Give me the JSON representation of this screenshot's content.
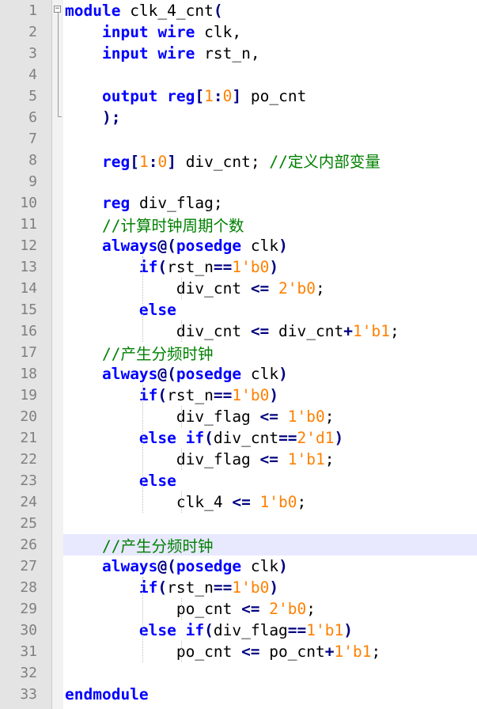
{
  "editor": {
    "current_line": 26,
    "colors": {
      "keyword": "#0000ff",
      "number": "#ff8000",
      "operator": "#000080",
      "comment": "#008000",
      "identifier": "#000000",
      "line_number": "#808080",
      "current_line_bg": "#e8e8ff",
      "gutter_bg": "#e4e4e4"
    },
    "lines": [
      {
        "n": "1",
        "tokens": [
          [
            "kw",
            "module"
          ],
          [
            "id",
            " clk_4_cnt"
          ],
          [
            "op",
            "("
          ]
        ]
      },
      {
        "n": "2",
        "tokens": [
          [
            "id",
            "    "
          ],
          [
            "kw",
            "input"
          ],
          [
            "id",
            " "
          ],
          [
            "kw",
            "wire"
          ],
          [
            "id",
            " clk,"
          ]
        ]
      },
      {
        "n": "3",
        "tokens": [
          [
            "id",
            "    "
          ],
          [
            "kw",
            "input"
          ],
          [
            "id",
            " "
          ],
          [
            "kw",
            "wire"
          ],
          [
            "id",
            " rst_n,"
          ]
        ]
      },
      {
        "n": "4",
        "tokens": []
      },
      {
        "n": "5",
        "tokens": [
          [
            "id",
            "    "
          ],
          [
            "kw",
            "output"
          ],
          [
            "id",
            " "
          ],
          [
            "kw",
            "reg"
          ],
          [
            "op",
            "["
          ],
          [
            "num",
            "1"
          ],
          [
            "op",
            ":"
          ],
          [
            "num",
            "0"
          ],
          [
            "op",
            "]"
          ],
          [
            "id",
            " po_cnt"
          ]
        ]
      },
      {
        "n": "6",
        "tokens": [
          [
            "id",
            "    "
          ],
          [
            "op",
            ");"
          ]
        ]
      },
      {
        "n": "7",
        "tokens": []
      },
      {
        "n": "8",
        "tokens": [
          [
            "id",
            "    "
          ],
          [
            "kw",
            "reg"
          ],
          [
            "op",
            "["
          ],
          [
            "num",
            "1"
          ],
          [
            "op",
            ":"
          ],
          [
            "num",
            "0"
          ],
          [
            "op",
            "]"
          ],
          [
            "id",
            " div_cnt; "
          ],
          [
            "cm",
            "//定义内部变量"
          ]
        ]
      },
      {
        "n": "9",
        "tokens": []
      },
      {
        "n": "10",
        "tokens": [
          [
            "id",
            "    "
          ],
          [
            "kw",
            "reg"
          ],
          [
            "id",
            " div_flag;"
          ]
        ]
      },
      {
        "n": "11",
        "tokens": [
          [
            "id",
            "    "
          ],
          [
            "cm",
            "//计算时钟周期个数"
          ]
        ]
      },
      {
        "n": "12",
        "tokens": [
          [
            "id",
            "    "
          ],
          [
            "kw",
            "always"
          ],
          [
            "op",
            "@("
          ],
          [
            "kw",
            "posedge"
          ],
          [
            "id",
            " clk"
          ],
          [
            "op",
            ")"
          ]
        ]
      },
      {
        "n": "13",
        "tokens": [
          [
            "id",
            "        "
          ],
          [
            "kw",
            "if"
          ],
          [
            "op",
            "("
          ],
          [
            "id",
            "rst_n"
          ],
          [
            "op",
            "=="
          ],
          [
            "num",
            "1'b0"
          ],
          [
            "op",
            ")"
          ]
        ]
      },
      {
        "n": "14",
        "tokens": [
          [
            "id",
            "            div_cnt "
          ],
          [
            "op",
            "<="
          ],
          [
            "id",
            " "
          ],
          [
            "num",
            "2'b0"
          ],
          [
            "id",
            ";"
          ]
        ]
      },
      {
        "n": "15",
        "tokens": [
          [
            "id",
            "        "
          ],
          [
            "kw",
            "else"
          ]
        ]
      },
      {
        "n": "16",
        "tokens": [
          [
            "id",
            "            div_cnt "
          ],
          [
            "op",
            "<="
          ],
          [
            "id",
            " div_cnt"
          ],
          [
            "op",
            "+"
          ],
          [
            "num",
            "1'b1"
          ],
          [
            "id",
            ";"
          ]
        ]
      },
      {
        "n": "17",
        "tokens": [
          [
            "id",
            "    "
          ],
          [
            "cm",
            "//产生分频时钟"
          ]
        ]
      },
      {
        "n": "18",
        "tokens": [
          [
            "id",
            "    "
          ],
          [
            "kw",
            "always"
          ],
          [
            "op",
            "@("
          ],
          [
            "kw",
            "posedge"
          ],
          [
            "id",
            " clk"
          ],
          [
            "op",
            ")"
          ]
        ]
      },
      {
        "n": "19",
        "tokens": [
          [
            "id",
            "        "
          ],
          [
            "kw",
            "if"
          ],
          [
            "op",
            "("
          ],
          [
            "id",
            "rst_n"
          ],
          [
            "op",
            "=="
          ],
          [
            "num",
            "1'b0"
          ],
          [
            "op",
            ")"
          ]
        ]
      },
      {
        "n": "20",
        "tokens": [
          [
            "id",
            "            div_flag "
          ],
          [
            "op",
            "<="
          ],
          [
            "id",
            " "
          ],
          [
            "num",
            "1'b0"
          ],
          [
            "id",
            ";"
          ]
        ]
      },
      {
        "n": "21",
        "tokens": [
          [
            "id",
            "        "
          ],
          [
            "kw",
            "else"
          ],
          [
            "id",
            " "
          ],
          [
            "kw",
            "if"
          ],
          [
            "op",
            "("
          ],
          [
            "id",
            "div_cnt"
          ],
          [
            "op",
            "=="
          ],
          [
            "num",
            "2'd1"
          ],
          [
            "op",
            ")"
          ]
        ]
      },
      {
        "n": "22",
        "tokens": [
          [
            "id",
            "            div_flag "
          ],
          [
            "op",
            "<="
          ],
          [
            "id",
            " "
          ],
          [
            "num",
            "1'b1"
          ],
          [
            "id",
            ";"
          ]
        ]
      },
      {
        "n": "23",
        "tokens": [
          [
            "id",
            "        "
          ],
          [
            "kw",
            "else"
          ]
        ]
      },
      {
        "n": "24",
        "tokens": [
          [
            "id",
            "            clk_4 "
          ],
          [
            "op",
            "<="
          ],
          [
            "id",
            " "
          ],
          [
            "num",
            "1'b0"
          ],
          [
            "id",
            ";"
          ]
        ]
      },
      {
        "n": "25",
        "tokens": []
      },
      {
        "n": "26",
        "tokens": [
          [
            "id",
            "    "
          ],
          [
            "cm",
            "//产生分频时钟"
          ]
        ]
      },
      {
        "n": "27",
        "tokens": [
          [
            "id",
            "    "
          ],
          [
            "kw",
            "always"
          ],
          [
            "op",
            "@("
          ],
          [
            "kw",
            "posedge"
          ],
          [
            "id",
            " clk"
          ],
          [
            "op",
            ")"
          ]
        ]
      },
      {
        "n": "28",
        "tokens": [
          [
            "id",
            "        "
          ],
          [
            "kw",
            "if"
          ],
          [
            "op",
            "("
          ],
          [
            "id",
            "rst_n"
          ],
          [
            "op",
            "=="
          ],
          [
            "num",
            "1'b0"
          ],
          [
            "op",
            ")"
          ]
        ]
      },
      {
        "n": "29",
        "tokens": [
          [
            "id",
            "            po_cnt "
          ],
          [
            "op",
            "<="
          ],
          [
            "id",
            " "
          ],
          [
            "num",
            "2'b0"
          ],
          [
            "id",
            ";"
          ]
        ]
      },
      {
        "n": "30",
        "tokens": [
          [
            "id",
            "        "
          ],
          [
            "kw",
            "else"
          ],
          [
            "id",
            " "
          ],
          [
            "kw",
            "if"
          ],
          [
            "op",
            "("
          ],
          [
            "id",
            "div_flag"
          ],
          [
            "op",
            "=="
          ],
          [
            "num",
            "1'b1"
          ],
          [
            "op",
            ")"
          ]
        ]
      },
      {
        "n": "31",
        "tokens": [
          [
            "id",
            "            po_cnt "
          ],
          [
            "op",
            "<="
          ],
          [
            "id",
            " po_cnt"
          ],
          [
            "op",
            "+"
          ],
          [
            "num",
            "1'b1"
          ],
          [
            "id",
            ";"
          ]
        ]
      },
      {
        "n": "32",
        "tokens": []
      },
      {
        "n": "33",
        "tokens": [
          [
            "kw",
            "endmodule"
          ]
        ]
      }
    ]
  }
}
